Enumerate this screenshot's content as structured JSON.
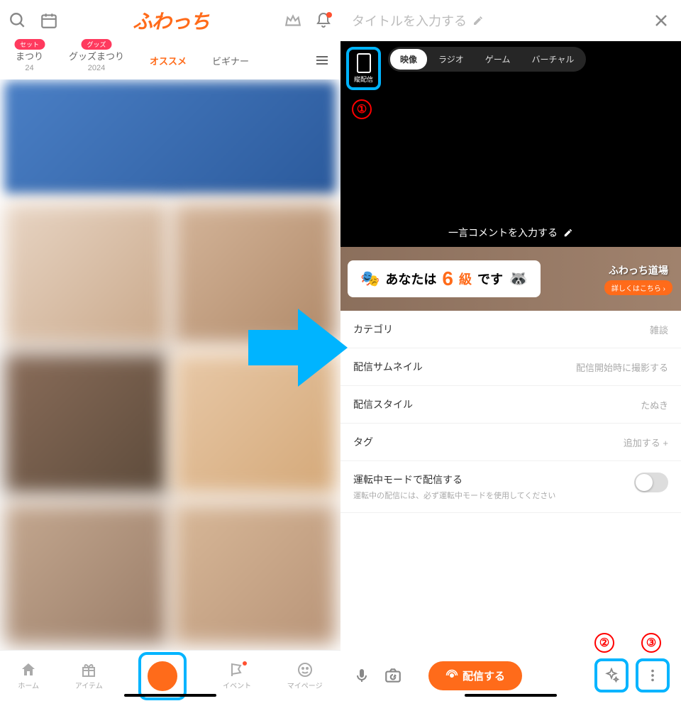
{
  "left": {
    "logo": "ふわっち",
    "tabs": [
      {
        "label": "まつり",
        "sub": "24",
        "badge": "セット"
      },
      {
        "label": "グッズまつり",
        "sub": "2024",
        "badge": "グッズ"
      },
      {
        "label": "オススメ",
        "active": true
      },
      {
        "label": "ビギナー"
      }
    ],
    "nav": {
      "home": "ホーム",
      "item": "アイテム",
      "event": "イベント",
      "mypage": "マイページ"
    }
  },
  "right": {
    "title_placeholder": "タイトルを入力する",
    "orient_label": "縦配信",
    "modes": [
      "映像",
      "ラジオ",
      "ゲーム",
      "バーチャル"
    ],
    "comment_placeholder": "一言コメントを入力する",
    "rank": {
      "prefix": "あなたは",
      "num": "6",
      "grade": "級",
      "suffix": "です",
      "dojo": "ふわっち道場",
      "details": "詳しくはこちら"
    },
    "settings": {
      "category": {
        "label": "カテゴリ",
        "value": "雑談"
      },
      "thumbnail": {
        "label": "配信サムネイル",
        "value": "配信開始時に撮影する"
      },
      "style": {
        "label": "配信スタイル",
        "value": "たぬき"
      },
      "tag": {
        "label": "タグ",
        "value": "追加する +"
      },
      "driving": {
        "label": "運転中モードで配信する",
        "sub": "運転中の配信には、必ず運転中モードを使用してください"
      }
    },
    "broadcast_btn": "配信する"
  },
  "annotations": {
    "n1": "①",
    "n2": "②",
    "n3": "③"
  }
}
